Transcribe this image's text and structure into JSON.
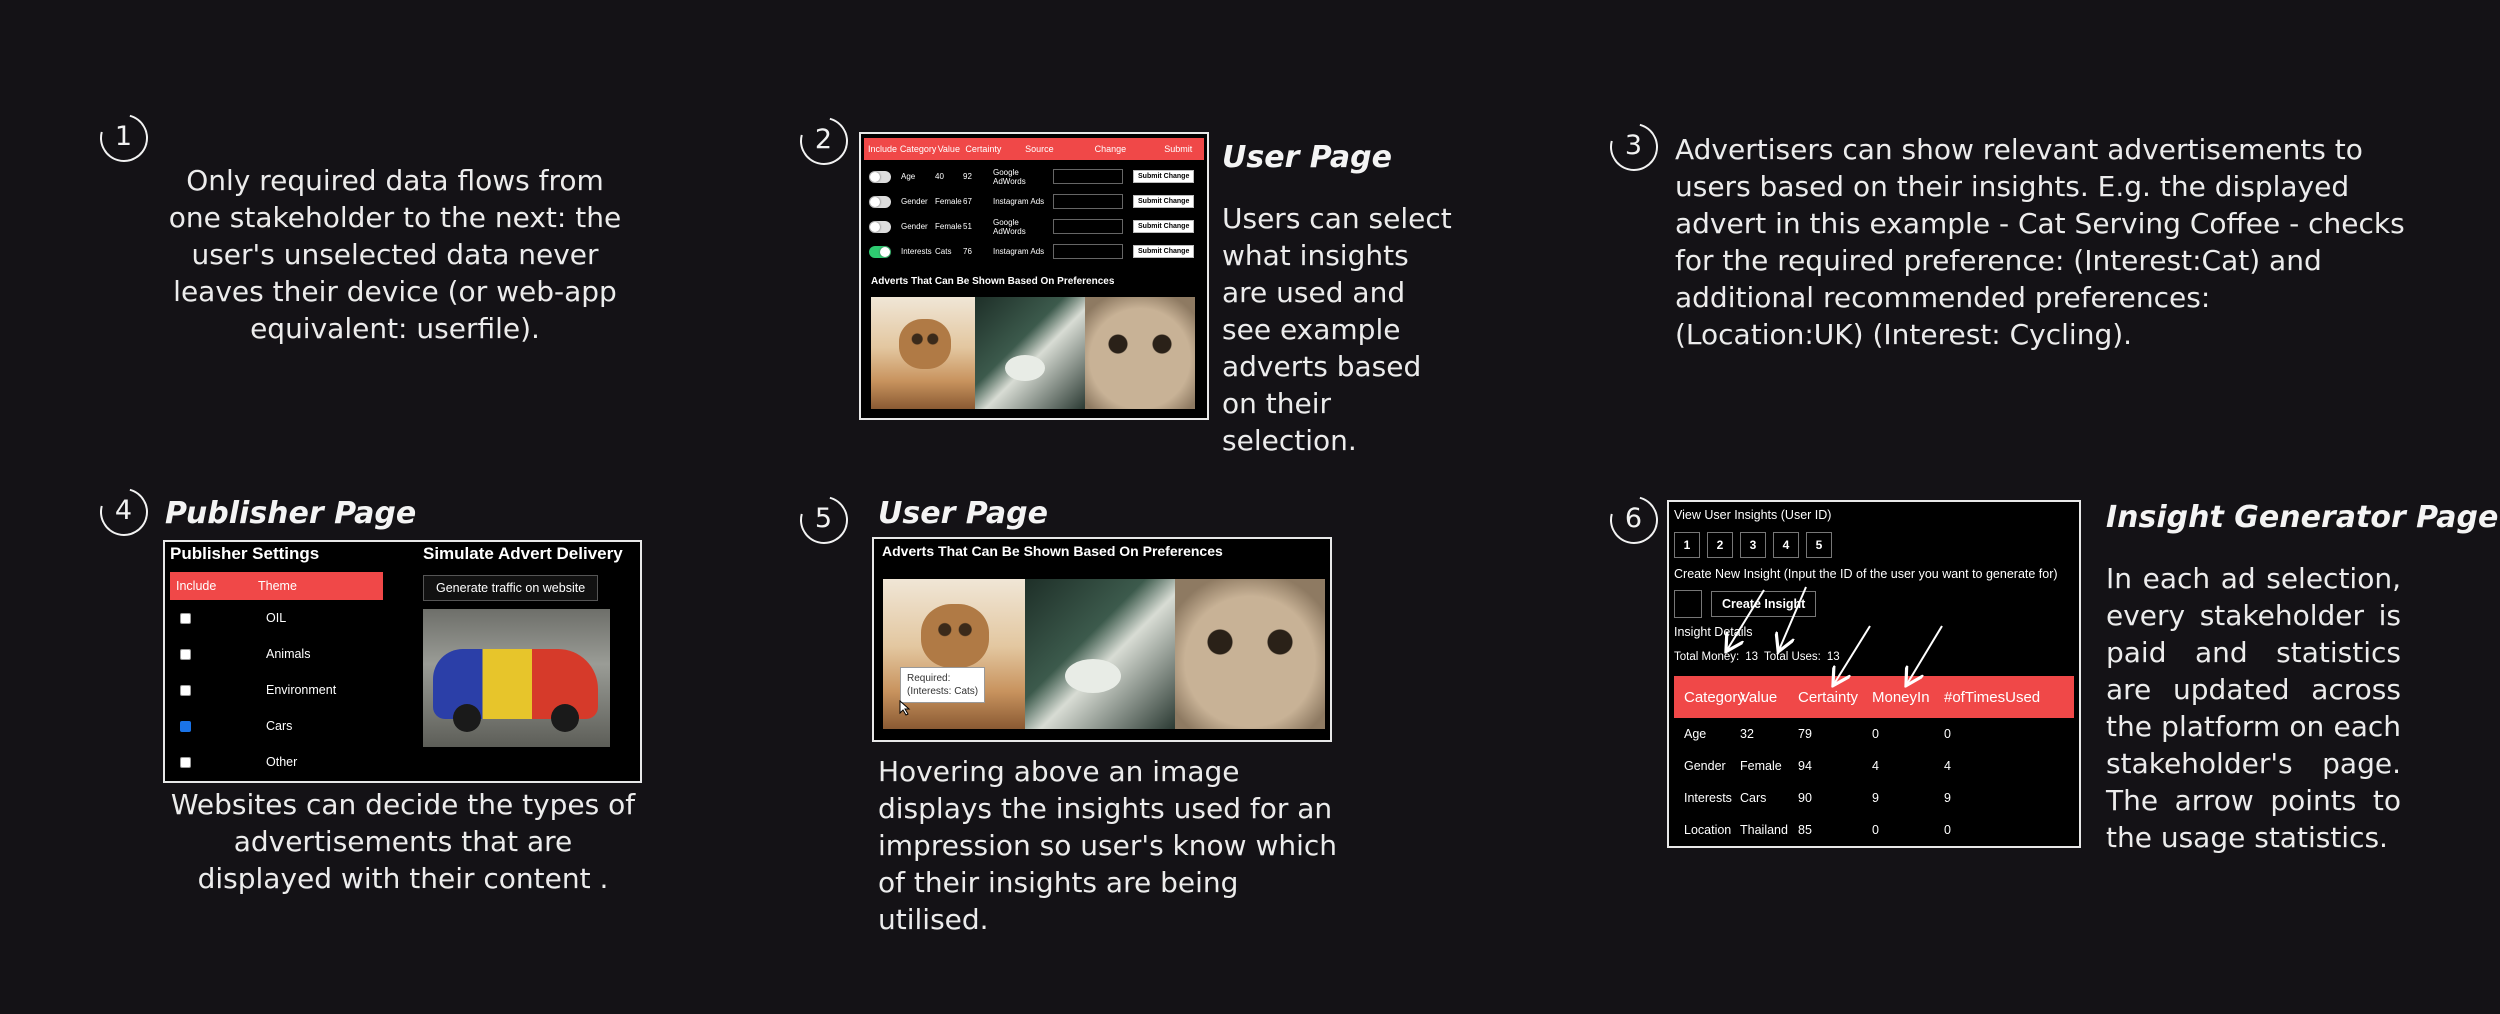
{
  "sections": [
    {
      "number": "1",
      "text": "Only required data flows from one stakeholder to the next: the user's unselected data never leaves their device (or web-app equivalent: userfile)."
    },
    {
      "number": "2",
      "heading": "User Page",
      "text": "Users can select what insights are used and see example adverts based on their selection."
    },
    {
      "number": "3",
      "text": "Advertisers can show relevant advertisements to users based on their insights. E.g. the displayed advert in this example - Cat Serving Coffee - checks for the required preference: (Interest:Cat) and additional recommended preferences: (Location:UK) (Interest: Cycling)."
    },
    {
      "number": "4",
      "heading": "Publisher Page",
      "text": "Websites can decide the types of advertisements that are displayed with their content ."
    },
    {
      "number": "5",
      "heading": "User Page",
      "text": "Hovering above an image displays the insights used for an impression so user's know which of their insights are being utilised."
    },
    {
      "number": "6",
      "heading": "Insight Generator Page",
      "text": "In each ad selection, every stakeholder is paid and statistics are updated across the platform on each stakeholder's page. The arrow points to the usage statistics."
    }
  ],
  "user_page_1": {
    "columns": [
      "Include",
      "Category",
      "Value",
      "Certainty",
      "Source",
      "Change",
      "Submit"
    ],
    "rows": [
      {
        "on": false,
        "category": "Age",
        "value": "40",
        "certainty": "92",
        "source": "Google AdWords",
        "button": "Submit Change"
      },
      {
        "on": false,
        "category": "Gender",
        "value": "Female",
        "certainty": "67",
        "source": "Instagram Ads",
        "button": "Submit Change"
      },
      {
        "on": false,
        "category": "Gender",
        "value": "Female",
        "certainty": "51",
        "source": "Google AdWords",
        "button": "Submit Change"
      },
      {
        "on": true,
        "category": "Interests",
        "value": "Cats",
        "certainty": "76",
        "source": "Instagram Ads",
        "button": "Submit Change"
      }
    ],
    "adverts_title": "Adverts That Can Be Shown Based On Preferences"
  },
  "publisher_page": {
    "settings_title": "Publisher Settings",
    "columns": [
      "Include",
      "Theme"
    ],
    "rows": [
      {
        "checked": false,
        "theme": "OIL"
      },
      {
        "checked": false,
        "theme": "Animals"
      },
      {
        "checked": false,
        "theme": "Environment"
      },
      {
        "checked": true,
        "theme": "Cars"
      },
      {
        "checked": false,
        "theme": "Other"
      }
    ],
    "simulate_title": "Simulate Advert Delivery",
    "generate_button": "Generate traffic on website"
  },
  "user_page_2": {
    "adverts_title": "Adverts That Can Be Shown Based On Preferences",
    "tooltip_line1": "Required:",
    "tooltip_line2": "(Interests: Cats)"
  },
  "insight_page": {
    "view_label": "View User Insights (User ID)",
    "ids": [
      "1",
      "2",
      "3",
      "4",
      "5"
    ],
    "create_label": "Create New Insight (Input the ID of the user you want to generate for)",
    "create_button": "Create Insight",
    "details_label": "Insight Details",
    "total_money_label": "Total Money:",
    "total_money": "13",
    "total_uses_label": "Total Uses:",
    "total_uses": "13",
    "columns": [
      "Category",
      "Value",
      "Certainty",
      "MoneyIn",
      "#ofTimesUsed"
    ],
    "rows": [
      [
        "Age",
        "32",
        "79",
        "0",
        "0"
      ],
      [
        "Gender",
        "Female",
        "94",
        "4",
        "4"
      ],
      [
        "Interests",
        "Cars",
        "90",
        "9",
        "9"
      ],
      [
        "Location",
        "Thailand",
        "85",
        "0",
        "0"
      ]
    ]
  },
  "colors": {
    "background": "#141216",
    "accent": "#f04848",
    "toggle_on": "#2ecc71"
  }
}
